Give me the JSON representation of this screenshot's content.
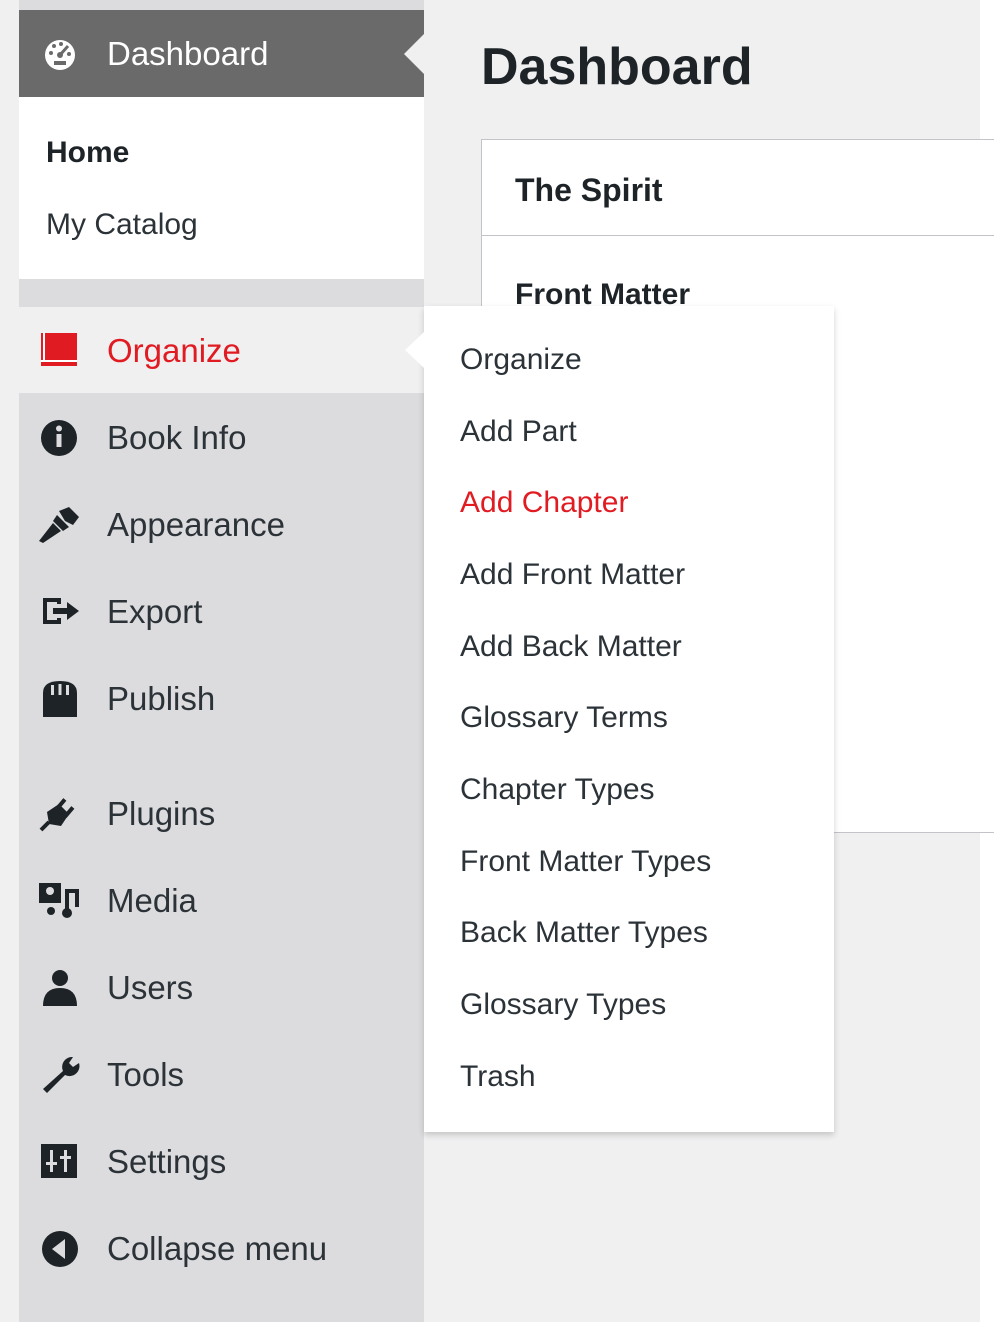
{
  "sidebar": {
    "dashboard": {
      "label": "Dashboard",
      "icon": "dashboard-gauge-icon",
      "submenu": [
        {
          "label": "Home",
          "current": true
        },
        {
          "label": "My Catalog",
          "current": false
        }
      ]
    },
    "items": [
      {
        "label": "Organize",
        "icon": "book-icon",
        "active": true
      },
      {
        "label": "Book Info",
        "icon": "info-icon",
        "active": false
      },
      {
        "label": "Appearance",
        "icon": "paintbrush-icon",
        "active": false
      },
      {
        "label": "Export",
        "icon": "export-icon",
        "active": false
      },
      {
        "label": "Publish",
        "icon": "store-icon",
        "active": false
      },
      {
        "label": "Plugins",
        "icon": "plugin-icon",
        "active": false
      },
      {
        "label": "Media",
        "icon": "media-icon",
        "active": false
      },
      {
        "label": "Users",
        "icon": "user-icon",
        "active": false
      },
      {
        "label": "Tools",
        "icon": "wrench-icon",
        "active": false
      },
      {
        "label": "Settings",
        "icon": "settings-icon",
        "active": false
      },
      {
        "label": "Collapse menu",
        "icon": "collapse-arrow-icon",
        "active": false
      }
    ]
  },
  "main": {
    "title": "Dashboard",
    "card": {
      "title": "The Spirit",
      "section": "Front Matter"
    }
  },
  "flyout": {
    "items": [
      {
        "label": "Organize",
        "current": false
      },
      {
        "label": "Add Part",
        "current": false
      },
      {
        "label": "Add Chapter",
        "current": true
      },
      {
        "label": "Add Front Matter",
        "current": false
      },
      {
        "label": "Add Back Matter",
        "current": false
      },
      {
        "label": "Glossary Terms",
        "current": false
      },
      {
        "label": "Chapter Types",
        "current": false
      },
      {
        "label": "Front Matter Types",
        "current": false
      },
      {
        "label": "Back Matter Types",
        "current": false
      },
      {
        "label": "Glossary Types",
        "current": false
      },
      {
        "label": "Trash",
        "current": false
      }
    ]
  },
  "colors": {
    "accent": "#e11b22",
    "sidebar_bg": "#dcdcde",
    "dashboard_bg": "#6a6a6a",
    "content_bg": "#f0f0f1",
    "text": "#2c3338"
  }
}
